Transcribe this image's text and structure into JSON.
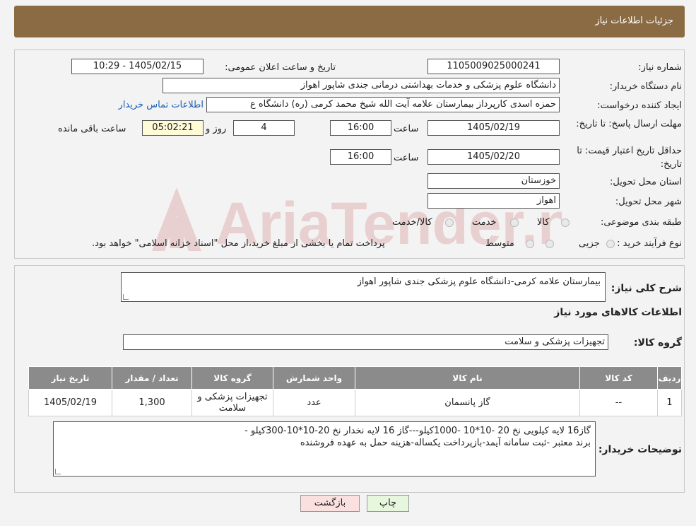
{
  "header": {
    "title": "جزئیات اطلاعات نیاز"
  },
  "form": {
    "need_number_label": "شماره نیاز:",
    "need_number": "1105009025000241",
    "announce_label": "تاریخ و ساعت اعلان عمومی:",
    "announce_value": "1405/02/15 - 10:29",
    "buyer_org_label": "نام دستگاه خریدار:",
    "buyer_org": "دانشگاه علوم پزشکی و خدمات بهداشتی درمانی جندی شاپور اهواز",
    "creator_label": "ایجاد کننده درخواست:",
    "creator": "حمزه اسدی کارپرداز بیمارستان علامه آیت الله شیخ محمد کرمی (ره) دانشگاه ع",
    "contact_link": "اطلاعات تماس خریدار",
    "deadline_label": "مهلت ارسال پاسخ: تا تاریخ:",
    "deadline_date": "1405/02/19",
    "time_label": "ساعت",
    "deadline_time": "16:00",
    "days_value": "4",
    "days_label": "روز و",
    "remaining_time": "05:02:21",
    "remaining_label": "ساعت باقی مانده",
    "validity_label": "حداقل تاریخ اعتبار قیمت: تا تاریخ:",
    "validity_date": "1405/02/20",
    "validity_time": "16:00",
    "province_label": "استان محل تحویل:",
    "province": "خوزستان",
    "city_label": "شهر محل تحویل:",
    "city": "اهواز",
    "category_label": "طبقه بندی موضوعی:",
    "category_options": [
      "کالا",
      "خدمت",
      "کالا/خدمت"
    ],
    "process_label": "نوع فرآیند خرید :",
    "process_options": [
      "جزیی",
      "متوسط"
    ],
    "process_note": "پرداخت تمام یا بخشی از مبلغ خرید،از محل \"اسناد خزانه اسلامی\" خواهد بود."
  },
  "summary": {
    "desc_label": "شرح کلی نیاز:",
    "desc_value": "بیمارستان  علامه کرمی-دانشگاه علوم پزشکی جندی شاپور اهواز",
    "goods_info_title": "اطلاعات کالاهای مورد نیاز",
    "goods_group_label": "گروه کالا:",
    "goods_group": "تجهیزات پزشکی و سلامت"
  },
  "table": {
    "headers": [
      "ردیف",
      "کد کالا",
      "نام کالا",
      "واحد شمارش",
      "گروه کالا",
      "تعداد / مقدار",
      "تاریخ نیاز"
    ],
    "rows": [
      [
        "1",
        "--",
        "گاز پانسمان",
        "عدد",
        "تجهیزات پزشکی و سلامت",
        "1,300",
        "1405/02/19"
      ]
    ]
  },
  "buyer_notes": {
    "label": "توضیحات خریدار:",
    "line1": "گاز16 لایه کیلویی نخ 20 -10*10 -1000کیلو---گاز 16 لایه نخدار نخ 20-10*10-300کیلو -",
    "line2": "برند معتبر -ثبت سامانه آیمد-بازپرداخت یکساله-هزینه حمل به عهده فروشنده"
  },
  "buttons": {
    "print": "چاپ",
    "back": "بازگشت"
  },
  "watermark": {
    "text": "AriaTender.neT"
  },
  "colors": {
    "header_bg": "#8b6b44",
    "table_header": "#8b8b8b",
    "print_btn": "#e6f7dd",
    "back_btn": "#fbe0e0"
  }
}
